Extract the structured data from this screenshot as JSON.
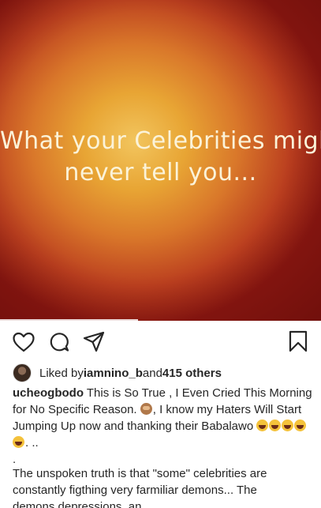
{
  "post_image": {
    "overlay_line_1": "What your Celebrities might",
    "overlay_line_2": "never tell you..."
  },
  "actions": {
    "like_icon": "heart-outline-icon",
    "comment_icon": "comment-bubble-icon",
    "share_icon": "paper-plane-icon",
    "save_icon": "bookmark-outline-icon"
  },
  "likes": {
    "prefix": "Liked by ",
    "user": "iamnino_b",
    "and": " and ",
    "others": "415 others"
  },
  "caption": {
    "username": "ucheogbodo",
    "text_1": " This is So True , I Even Cried This Morning for No Specific Reason. ",
    "text_2": ", I know my Haters Will Start Jumping Up now and thanking their Babalawo ",
    "text_3": ". ..",
    "dot": ".",
    "more_line_1": "The unspoken truth is that \"some\" celebrities are constantly figthing very farmiliar demons... The",
    "more_line_2": "demons depressions, an..."
  },
  "colors": {
    "gradient_center": "#f2c55e",
    "gradient_edge": "#8e1812",
    "overlay_text": "#fbf3d9",
    "text": "#262626"
  }
}
